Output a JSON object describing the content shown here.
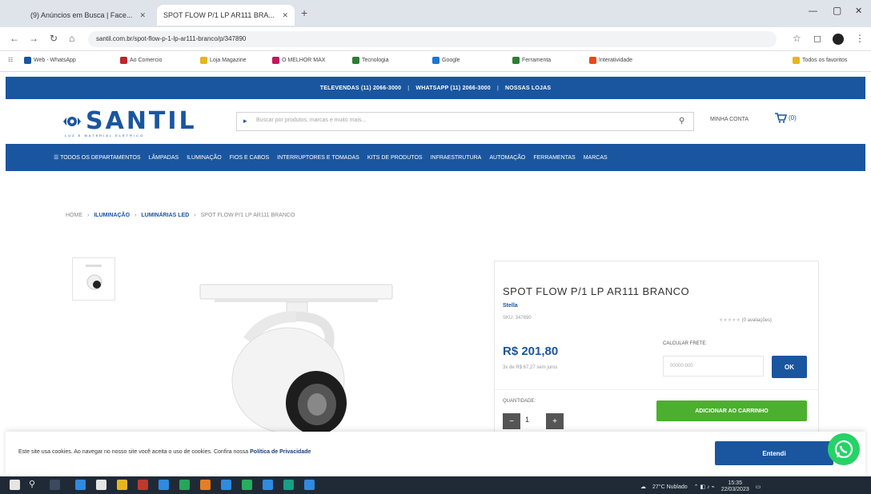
{
  "browser": {
    "tabs": [
      {
        "label": "(9) Anúncios em Busca | Face..."
      },
      {
        "label": "SPOT FLOW P/1 LP AR111 BRA..."
      }
    ],
    "url": "santil.com.br/spot-flow-p-1-lp-ar111-branco/p/347890",
    "bookmarks": [
      "Web - WhatsApp",
      "Ao Comercio",
      "Loja Magazine",
      "O MELHOR MAX",
      "Tecnologia",
      "Google",
      "Ferramenta",
      "Interatividade"
    ],
    "other_bookmarks": "Todos os favoritos"
  },
  "site": {
    "topstrip": [
      "TELEVENDAS (11) 2066-3000",
      "WHATSAPP (11) 2066-3000",
      "NOSSAS LOJAS"
    ],
    "logo": "SANTIL",
    "logo_tag": "LUZ E MATERIAL ELÉTRICO",
    "search_placeholder": "Buscar por produtos, marcas e muito mais...",
    "account_label": "MINHA CONTA",
    "cart_count": "(0)",
    "nav": [
      "TODOS OS DEPARTAMENTOS",
      "LÂMPADAS",
      "ILUMINAÇÃO",
      "FIOS E CABOS",
      "INTERRUPTORES E TOMADAS",
      "KITS DE PRODUTOS",
      "INFRAESTRUTURA",
      "AUTOMAÇÃO",
      "FERRAMENTAS",
      "MARCAS"
    ]
  },
  "breadcrumb": {
    "home": "HOME",
    "level1": "ILUMINAÇÃO",
    "level2": "LUMINÁRIAS LED",
    "current": "SPOT FLOW P/1 LP AR111 BRANCO"
  },
  "product": {
    "title": "SPOT FLOW P/1 LP AR111 BRANCO",
    "brand": "Stella",
    "sku": "SKU: 347890",
    "reviews": "(0 avaliações)",
    "price": "R$ 201,80",
    "installments": "3x de R$ 67,27 sem juros",
    "shipping_label": "CALCULAR FRETE:",
    "cep_placeholder": "00000-000",
    "ok_label": "OK",
    "quantity_label": "QUANTIDADE:",
    "quantity": "1",
    "add_to_cart": "ADICIONAR AO CARRINHO"
  },
  "cookie": {
    "text": "Este site usa cookies. Ao navegar no nosso site você aceita o uso de cookies. Confira nossa ",
    "policy_link": "Política de Privacidade",
    "button": "Entendi"
  },
  "taskbar": {
    "weather": "27°C Nublado",
    "time": "15:35",
    "date": "22/03/2023"
  }
}
